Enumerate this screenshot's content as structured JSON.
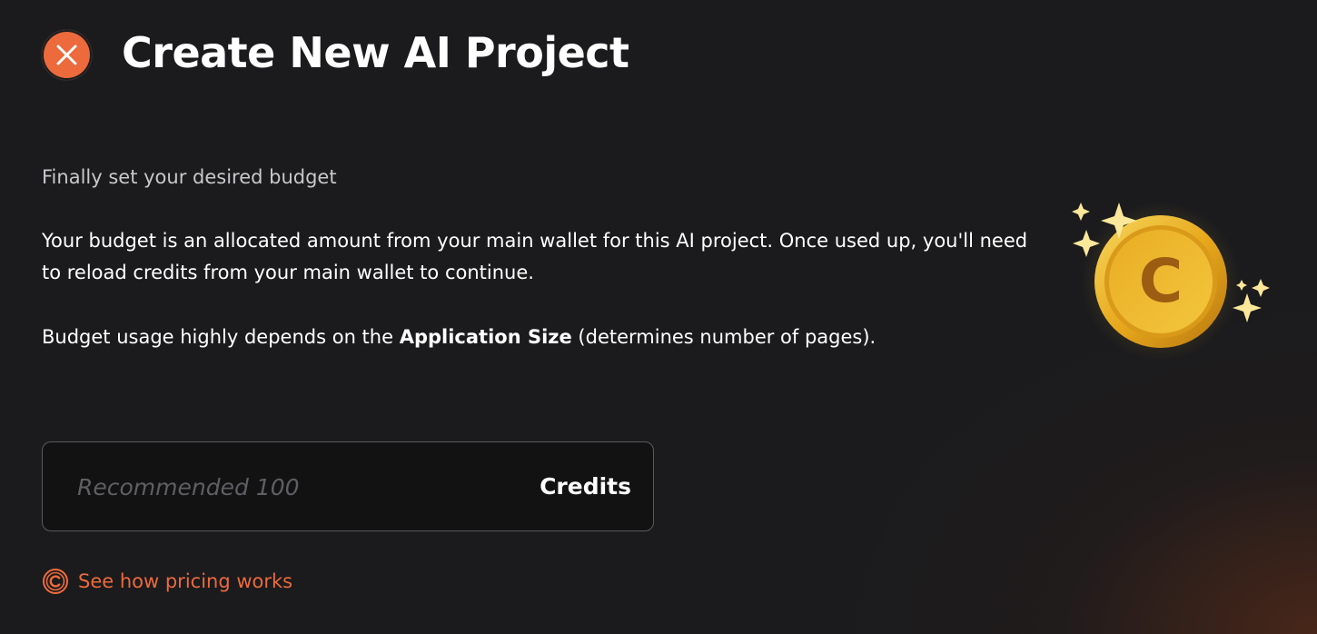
{
  "header": {
    "title": "Create New AI Project",
    "close_icon": "close-icon"
  },
  "content": {
    "subtitle": "Finally set your desired budget",
    "description": "Your budget is an allocated amount from your main wallet for this AI project. Once used up, you'll need to reload credits from your main wallet to continue.",
    "usage_note_prefix": "Budget usage highly depends on the ",
    "usage_note_bold": "Application Size",
    "usage_note_suffix": " (determines number of pages)."
  },
  "illustration": {
    "icon": "credit-coin-icon",
    "coin_letter": "C"
  },
  "budget_field": {
    "value": "",
    "placeholder": "Recommended 100",
    "unit": "Credits"
  },
  "pricing_link": {
    "icon": "credit-icon",
    "label": "See how pricing works"
  },
  "colors": {
    "background": "#1b1b1d",
    "accent": "#ec6a3c",
    "coin_gold": "#e8b52a"
  }
}
